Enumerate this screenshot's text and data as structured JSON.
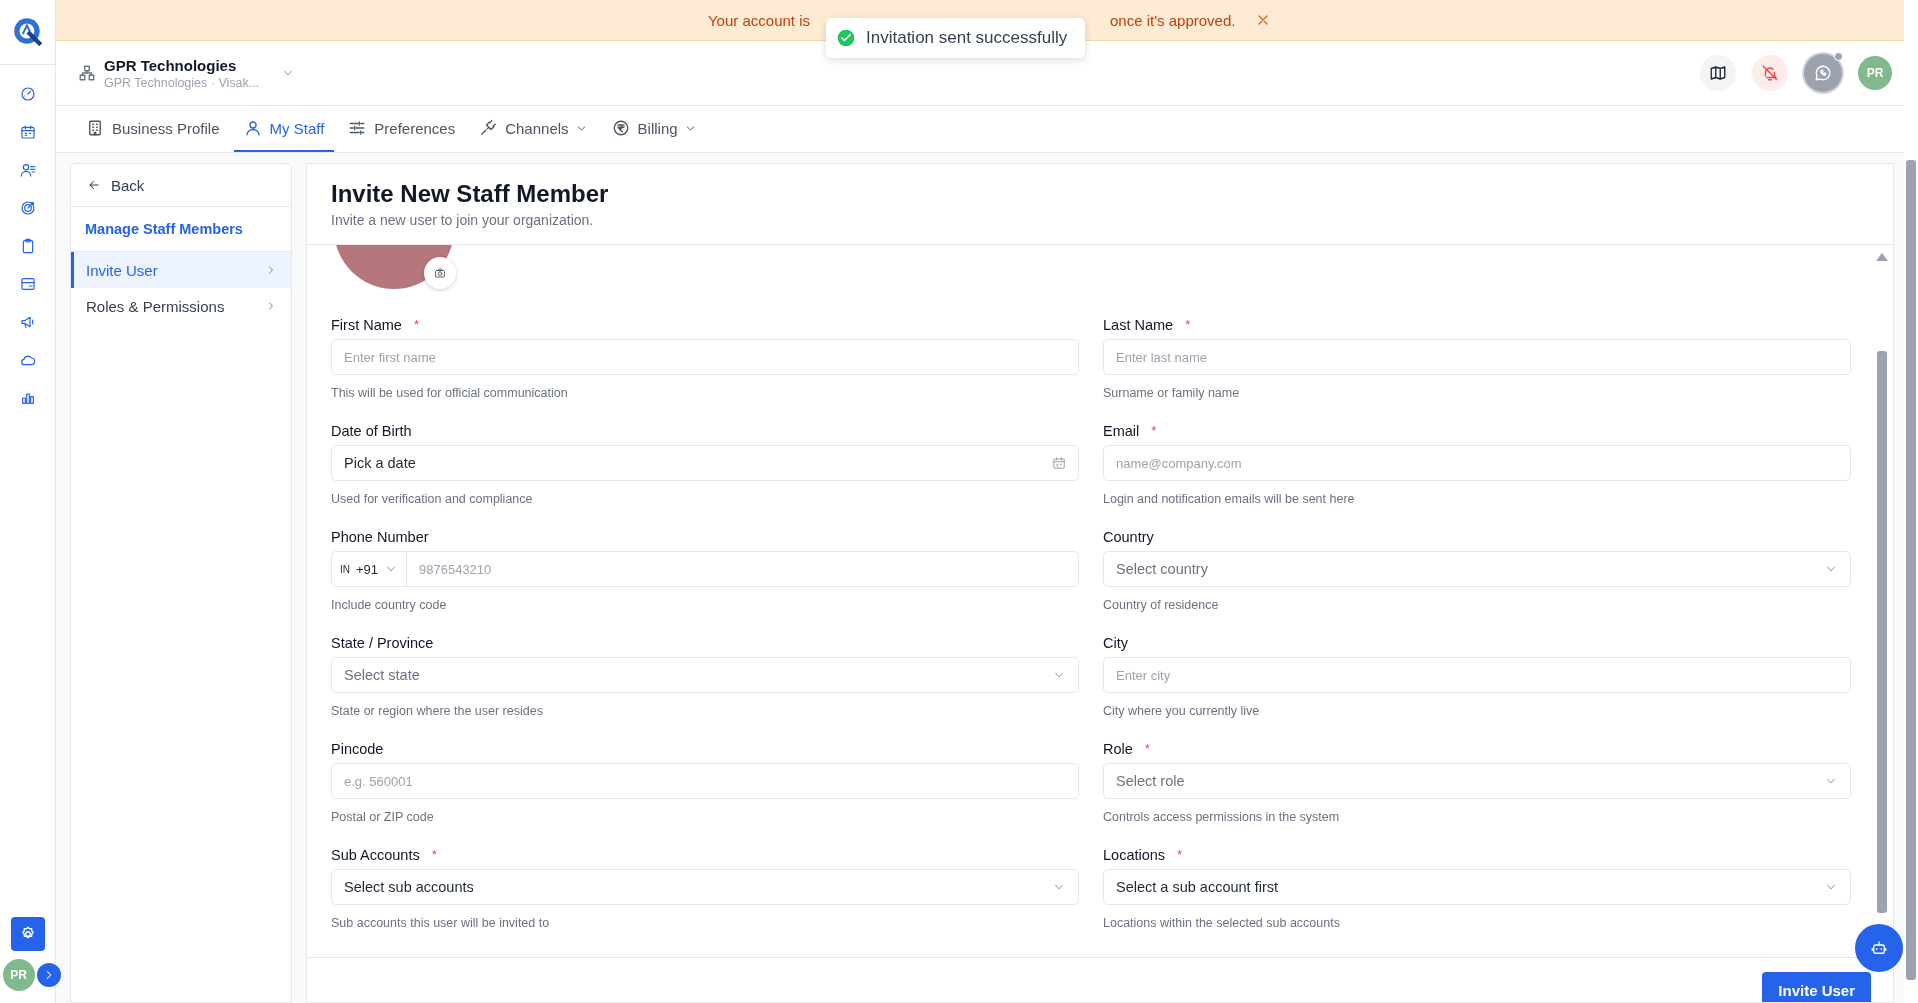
{
  "banner": {
    "text_start": "Your account is",
    "text_end": "once it's approved."
  },
  "toast": {
    "message": "Invitation sent successfully"
  },
  "rail": [
    {
      "kind": "gauge",
      "selected": false
    },
    {
      "kind": "calendar",
      "selected": false
    },
    {
      "kind": "users",
      "selected": false
    },
    {
      "kind": "target",
      "selected": false
    },
    {
      "kind": "clipboard",
      "selected": false
    },
    {
      "kind": "card",
      "selected": false
    },
    {
      "kind": "megaphone",
      "selected": false
    },
    {
      "kind": "cloud",
      "selected": false
    },
    {
      "kind": "chart",
      "selected": false
    }
  ],
  "rail_bottom": {
    "settings_selected": true,
    "avatar": "PR"
  },
  "org": {
    "name": "GPR Technologies",
    "subtitle": "GPR Technologies · Visak..."
  },
  "header": {
    "avatar": "PR"
  },
  "tabs": [
    {
      "kind": "building",
      "label": "Business Profile",
      "selected": false,
      "dropdown": false
    },
    {
      "kind": "user",
      "label": "My Staff",
      "selected": true,
      "dropdown": false
    },
    {
      "kind": "sliders",
      "label": "Preferences",
      "selected": false,
      "dropdown": false
    },
    {
      "kind": "plug",
      "label": "Channels",
      "selected": false,
      "dropdown": true
    },
    {
      "kind": "rupee",
      "label": "Billing",
      "selected": false,
      "dropdown": true
    }
  ],
  "subnav": {
    "back": "Back",
    "title": "Manage Staff Members",
    "items": [
      {
        "label": "Invite User",
        "selected": true
      },
      {
        "label": "Roles & Permissions",
        "selected": false
      }
    ]
  },
  "form": {
    "title": "Invite New Staff Member",
    "subtitle": "Invite a new user to join your organization.",
    "fields": [
      {
        "kind": "text",
        "label": "First Name",
        "required": true,
        "placeholder": "Enter first name",
        "help": "This will be used for official communication"
      },
      {
        "kind": "text",
        "label": "Last Name",
        "required": true,
        "placeholder": "Enter last name",
        "help": "Surname or family name"
      },
      {
        "kind": "date",
        "label": "Date of Birth",
        "required": false,
        "placeholder": "Pick a date",
        "help": "Used for verification and compliance"
      },
      {
        "kind": "text",
        "label": "Email",
        "required": true,
        "placeholder": "name@company.com",
        "help": "Login and notification emails will be sent here"
      },
      {
        "kind": "phone",
        "label": "Phone Number",
        "required": false,
        "country_code": "IN",
        "dial_code": "+91",
        "placeholder": "9876543210",
        "help": "Include country code"
      },
      {
        "kind": "select",
        "label": "Country",
        "required": false,
        "placeholder": "Select country",
        "help": "Country of residence"
      },
      {
        "kind": "select",
        "label": "State / Province",
        "required": false,
        "placeholder": "Select state",
        "help": "State or region where the user resides"
      },
      {
        "kind": "text",
        "label": "City",
        "required": false,
        "placeholder": "Enter city",
        "help": "City where you currently live"
      },
      {
        "kind": "text",
        "label": "Pincode",
        "required": false,
        "placeholder": "e.g. 560001",
        "help": "Postal or ZIP code"
      },
      {
        "kind": "select",
        "label": "Role",
        "required": true,
        "placeholder": "Select role",
        "help": "Controls access permissions in the system"
      },
      {
        "kind": "multiselect",
        "label": "Sub Accounts",
        "required": true,
        "placeholder": "Select sub accounts",
        "help": "Sub accounts this user will be invited to"
      },
      {
        "kind": "multiselect",
        "label": "Locations",
        "required": true,
        "placeholder": "Select a sub account first",
        "help": "Locations within the selected sub accounts"
      }
    ],
    "required_mark": "*",
    "submit": "Invite User"
  }
}
